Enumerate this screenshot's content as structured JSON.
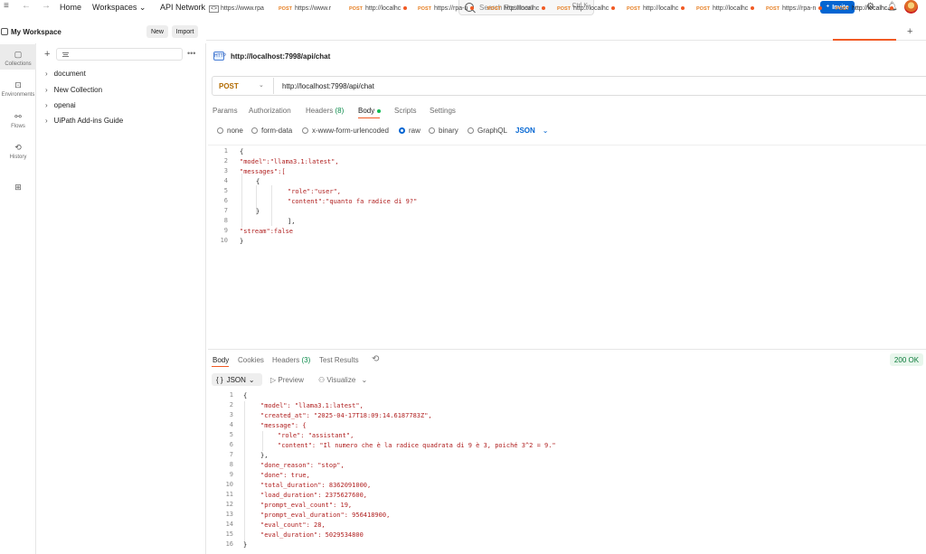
{
  "topbar": {
    "home": "Home",
    "workspaces": "Workspaces",
    "api_network": "API Network",
    "search_placeholder": "Search Postman",
    "search_shortcut": "Ctrl K",
    "invite": "Invite"
  },
  "workspace": {
    "title": "My Workspace",
    "new_label": "New",
    "import_label": "Import"
  },
  "rail": [
    {
      "label": "Collections",
      "icon": "collections-icon",
      "active": true
    },
    {
      "label": "Environments",
      "icon": "environments-icon",
      "active": false
    },
    {
      "label": "Flows",
      "icon": "flows-icon",
      "active": false
    },
    {
      "label": "History",
      "icon": "history-icon",
      "active": false
    },
    {
      "label": "",
      "icon": "configure-sidebar-icon",
      "active": false
    }
  ],
  "collections": [
    "document",
    "New Collection",
    "openai",
    "UiPath Add-ins Guide"
  ],
  "tabs": [
    {
      "method": "",
      "label": "https://www.rpa",
      "dot": false
    },
    {
      "method": "POST",
      "label": "https://www.r",
      "dot": false
    },
    {
      "method": "POST",
      "label": "http://localhc",
      "dot": true
    },
    {
      "method": "POST",
      "label": "https://rpa-n",
      "dot": true
    },
    {
      "method": "POST",
      "label": "http://localhc",
      "dot": true
    },
    {
      "method": "POST",
      "label": "http://localhc",
      "dot": true
    },
    {
      "method": "POST",
      "label": "http://localhc",
      "dot": true
    },
    {
      "method": "POST",
      "label": "http://localhc",
      "dot": true
    },
    {
      "method": "POST",
      "label": "https://rpa-n",
      "dot": true
    },
    {
      "method": "POST",
      "label": "http://localhc",
      "dot": true
    }
  ],
  "request": {
    "title": "http://localhost:7998/api/chat",
    "method": "POST",
    "url": "http://localhost:7998/api/chat",
    "tabs": {
      "params": "Params",
      "authorization": "Authorization",
      "headers": "Headers",
      "headers_count": "(8)",
      "body": "Body",
      "scripts": "Scripts",
      "settings": "Settings"
    },
    "body_types": [
      "none",
      "form-data",
      "x-www-form-urlencoded",
      "raw",
      "binary",
      "GraphQL"
    ],
    "selected_body_type": "raw",
    "format": "JSON"
  },
  "request_body": [
    "{",
    "\"model\":\"llama3.1:latest\",",
    "\"messages\":[",
    "{",
    "\"role\":\"user\",",
    "\"content\":\"quanto fa radice di 9?\"",
    "}",
    "],",
    "\"stream\":false",
    "}"
  ],
  "response": {
    "tabs": {
      "body": "Body",
      "cookies": "Cookies",
      "headers": "Headers",
      "headers_count": "(3)",
      "test_results": "Test Results"
    },
    "status": "200 OK",
    "format": "JSON",
    "preview": "Preview",
    "visualize": "Visualize"
  },
  "response_body": [
    "{",
    "\"model\": \"llama3.1:latest\",",
    "\"created_at\": \"2025-04-17T18:09:14.6187783Z\",",
    "\"message\": {",
    "\"role\": \"assistant\",",
    "\"content\": \"Il numero che è la radice quadrata di 9 è 3, poiché 3^2 = 9.\"",
    "},",
    "\"done_reason\": \"stop\",",
    "\"done\": true,",
    "\"total_duration\": 8362091000,",
    "\"load_duration\": 2375627600,",
    "\"prompt_eval_count\": 19,",
    "\"prompt_eval_duration\": 956418900,",
    "\"eval_count\": 28,",
    "\"eval_duration\": 5029534800",
    "}"
  ]
}
